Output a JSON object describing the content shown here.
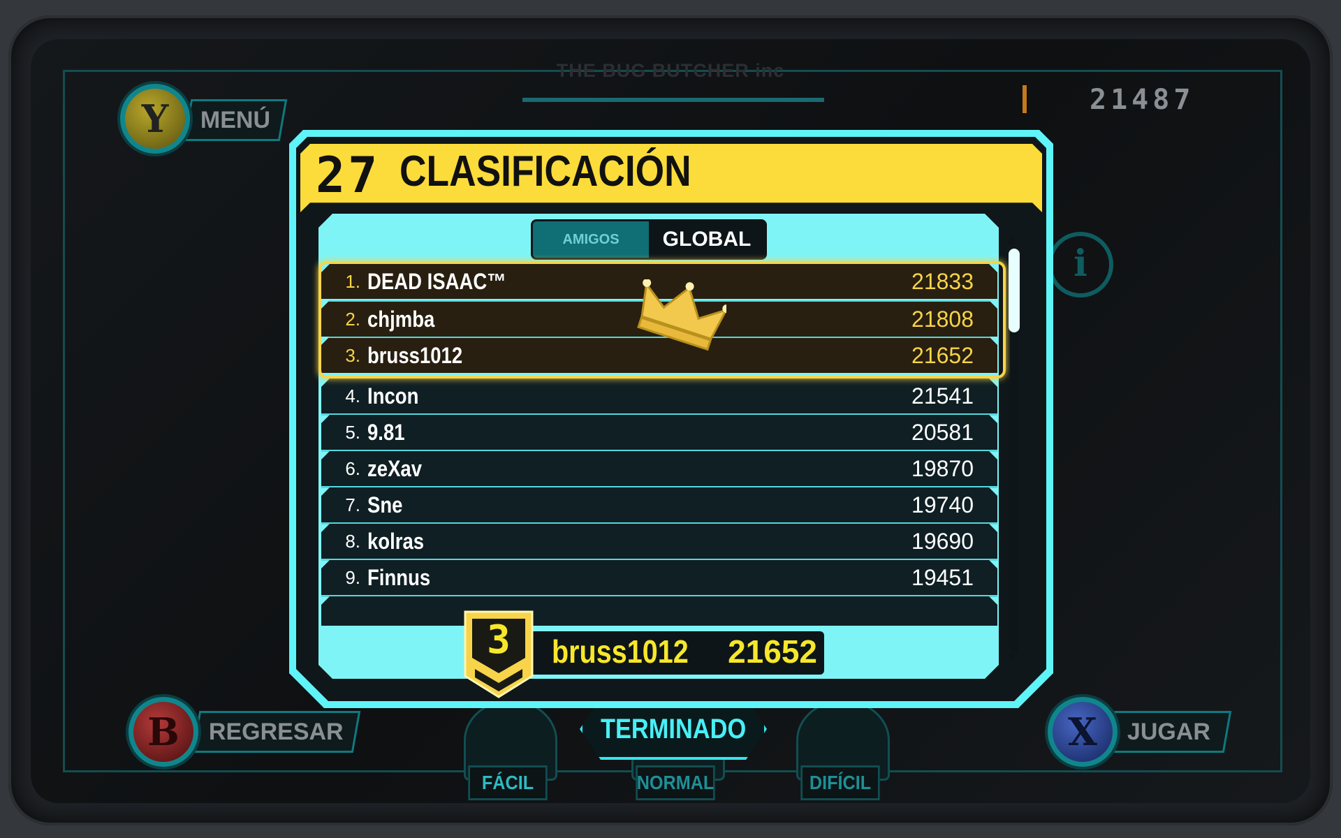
{
  "header": {
    "studio": "THE BUG BUTCHER inc",
    "top_score": "21487"
  },
  "buttons": {
    "menu": {
      "key": "Y",
      "label": "MENÚ"
    },
    "back": {
      "key": "B",
      "label": "REGRESAR"
    },
    "play": {
      "key": "X",
      "label": "JUGAR"
    },
    "info_icon": "info-icon"
  },
  "panel": {
    "number": "27",
    "title": "CLASIFICACIÓN",
    "tabs": [
      {
        "label": "AMIGOS",
        "active": false
      },
      {
        "label": "GLOBAL",
        "active": true
      }
    ],
    "leaderboard": [
      {
        "rank": "1.",
        "name": "DEAD ISAAC™",
        "score": "21833"
      },
      {
        "rank": "2.",
        "name": "chjmba",
        "score": "21808"
      },
      {
        "rank": "3.",
        "name": "bruss1012",
        "score": "21652"
      },
      {
        "rank": "4.",
        "name": "Incon",
        "score": "21541"
      },
      {
        "rank": "5.",
        "name": "9.81",
        "score": "20581"
      },
      {
        "rank": "6.",
        "name": "zeXav",
        "score": "19870"
      },
      {
        "rank": "7.",
        "name": "Sne",
        "score": "19740"
      },
      {
        "rank": "8.",
        "name": "kolras",
        "score": "19690"
      },
      {
        "rank": "9.",
        "name": "Finnus",
        "score": "19451"
      }
    ],
    "player": {
      "rank": "3",
      "name": "bruss1012",
      "score": "21652"
    }
  },
  "difficulty": {
    "easy": "FÁCIL",
    "normal": "NORMAL",
    "hard": "DIFÍCIL",
    "status": "TERMINADO"
  },
  "colors": {
    "accent_cyan": "#5ef4f8",
    "header_yellow": "#fcdc3a",
    "gold": "#f7d44a"
  }
}
